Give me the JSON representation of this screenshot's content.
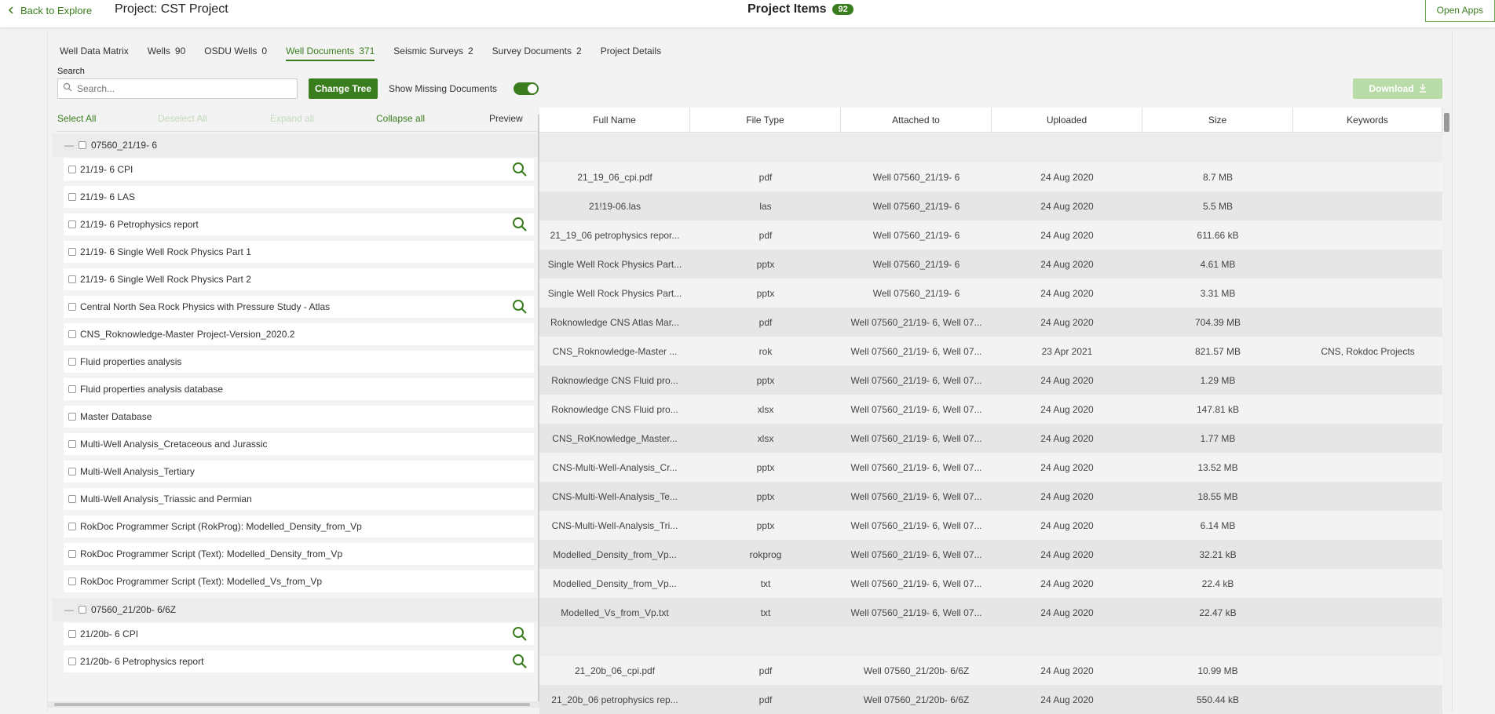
{
  "topbar": {
    "back_label": "Back to Explore",
    "project_title": "Project: CST Project",
    "items_title": "Project Items",
    "items_count": "92",
    "open_apps": "Open Apps"
  },
  "tabs": [
    {
      "label": "Well Data Matrix",
      "count": ""
    },
    {
      "label": "Wells",
      "count": "90"
    },
    {
      "label": "OSDU Wells",
      "count": "0"
    },
    {
      "label": "Well Documents",
      "count": "371"
    },
    {
      "label": "Seismic Surveys",
      "count": "2"
    },
    {
      "label": "Survey Documents",
      "count": "2"
    },
    {
      "label": "Project Details",
      "count": ""
    }
  ],
  "search": {
    "label": "Search",
    "placeholder": "Search..."
  },
  "toolbar": {
    "change_tree": "Change Tree",
    "show_missing": "Show Missing Documents",
    "download": "Download"
  },
  "tree_controls": {
    "select_all": "Select All",
    "deselect_all": "Deselect All",
    "expand_all": "Expand all",
    "collapse_all": "Collapse all",
    "preview": "Preview"
  },
  "columns": [
    "Full Name",
    "File Type",
    "Attached to",
    "Uploaded",
    "Size",
    "Keywords"
  ],
  "groups": [
    {
      "name": "07560_21/19- 6",
      "items": [
        {
          "label": "21/19- 6 CPI",
          "preview": true,
          "full_name": "21_19_06_cpi.pdf",
          "type": "pdf",
          "attached": "Well 07560_21/19- 6",
          "uploaded": "24 Aug 2020",
          "size": "8.7 MB",
          "keywords": ""
        },
        {
          "label": "21/19- 6 LAS",
          "preview": false,
          "full_name": "21!19-06.las",
          "type": "las",
          "attached": "Well 07560_21/19- 6",
          "uploaded": "24 Aug 2020",
          "size": "5.5 MB",
          "keywords": ""
        },
        {
          "label": "21/19- 6 Petrophysics report",
          "preview": true,
          "full_name": "21_19_06 petrophysics repor...",
          "type": "pdf",
          "attached": "Well 07560_21/19- 6",
          "uploaded": "24 Aug 2020",
          "size": "611.66 kB",
          "keywords": ""
        },
        {
          "label": "21/19- 6 Single Well Rock Physics Part 1",
          "preview": false,
          "full_name": "Single Well Rock Physics Part...",
          "type": "pptx",
          "attached": "Well 07560_21/19- 6",
          "uploaded": "24 Aug 2020",
          "size": "4.61 MB",
          "keywords": ""
        },
        {
          "label": "21/19- 6 Single Well Rock Physics Part 2",
          "preview": false,
          "full_name": "Single Well Rock Physics Part...",
          "type": "pptx",
          "attached": "Well 07560_21/19- 6",
          "uploaded": "24 Aug 2020",
          "size": "3.31 MB",
          "keywords": ""
        },
        {
          "label": "Central North Sea Rock Physics with Pressure Study - Atlas",
          "preview": true,
          "full_name": "Roknowledge CNS Atlas Mar...",
          "type": "pdf",
          "attached": "Well 07560_21/19- 6, Well 07...",
          "uploaded": "24 Aug 2020",
          "size": "704.39 MB",
          "keywords": ""
        },
        {
          "label": "CNS_Roknowledge-Master Project-Version_2020.2",
          "preview": false,
          "full_name": "CNS_Roknowledge-Master ...",
          "type": "rok",
          "attached": "Well 07560_21/19- 6, Well 07...",
          "uploaded": "23 Apr 2021",
          "size": "821.57 MB",
          "keywords": "CNS, Rokdoc Projects"
        },
        {
          "label": "Fluid properties analysis",
          "preview": false,
          "full_name": "Roknowledge CNS Fluid pro...",
          "type": "pptx",
          "attached": "Well 07560_21/19- 6, Well 07...",
          "uploaded": "24 Aug 2020",
          "size": "1.29 MB",
          "keywords": ""
        },
        {
          "label": "Fluid properties analysis database",
          "preview": false,
          "full_name": "Roknowledge CNS Fluid pro...",
          "type": "xlsx",
          "attached": "Well 07560_21/19- 6, Well 07...",
          "uploaded": "24 Aug 2020",
          "size": "147.81 kB",
          "keywords": ""
        },
        {
          "label": "Master Database",
          "preview": false,
          "full_name": "CNS_RoKnowledge_Master...",
          "type": "xlsx",
          "attached": "Well 07560_21/19- 6, Well 07...",
          "uploaded": "24 Aug 2020",
          "size": "1.77 MB",
          "keywords": ""
        },
        {
          "label": "Multi-Well Analysis_Cretaceous and Jurassic",
          "preview": false,
          "full_name": "CNS-Multi-Well-Analysis_Cr...",
          "type": "pptx",
          "attached": "Well 07560_21/19- 6, Well 07...",
          "uploaded": "24 Aug 2020",
          "size": "13.52 MB",
          "keywords": ""
        },
        {
          "label": "Multi-Well Analysis_Tertiary",
          "preview": false,
          "full_name": "CNS-Multi-Well-Analysis_Te...",
          "type": "pptx",
          "attached": "Well 07560_21/19- 6, Well 07...",
          "uploaded": "24 Aug 2020",
          "size": "18.55 MB",
          "keywords": ""
        },
        {
          "label": "Multi-Well Analysis_Triassic and Permian",
          "preview": false,
          "full_name": "CNS-Multi-Well-Analysis_Tri...",
          "type": "pptx",
          "attached": "Well 07560_21/19- 6, Well 07...",
          "uploaded": "24 Aug 2020",
          "size": "6.14 MB",
          "keywords": ""
        },
        {
          "label": "RokDoc Programmer Script (RokProg): Modelled_Density_from_Vp",
          "preview": false,
          "full_name": "Modelled_Density_from_Vp...",
          "type": "rokprog",
          "attached": "Well 07560_21/19- 6, Well 07...",
          "uploaded": "24 Aug 2020",
          "size": "32.21 kB",
          "keywords": ""
        },
        {
          "label": "RokDoc Programmer Script (Text): Modelled_Density_from_Vp",
          "preview": false,
          "full_name": "Modelled_Density_from_Vp...",
          "type": "txt",
          "attached": "Well 07560_21/19- 6, Well 07...",
          "uploaded": "24 Aug 2020",
          "size": "22.4 kB",
          "keywords": ""
        },
        {
          "label": "RokDoc Programmer Script (Text): Modelled_Vs_from_Vp",
          "preview": false,
          "full_name": "Modelled_Vs_from_Vp.txt",
          "type": "txt",
          "attached": "Well 07560_21/19- 6, Well 07...",
          "uploaded": "24 Aug 2020",
          "size": "22.47 kB",
          "keywords": ""
        }
      ]
    },
    {
      "name": "07560_21/20b- 6/6Z",
      "items": [
        {
          "label": "21/20b- 6 CPI",
          "preview": true,
          "full_name": "21_20b_06_cpi.pdf",
          "type": "pdf",
          "attached": "Well 07560_21/20b- 6/6Z",
          "uploaded": "24 Aug 2020",
          "size": "10.99 MB",
          "keywords": ""
        },
        {
          "label": "21/20b- 6 Petrophysics report",
          "preview": true,
          "full_name": "21_20b_06 petrophysics rep...",
          "type": "pdf",
          "attached": "Well 07560_21/20b- 6/6Z",
          "uploaded": "24 Aug 2020",
          "size": "550.44 kB",
          "keywords": ""
        }
      ]
    }
  ]
}
